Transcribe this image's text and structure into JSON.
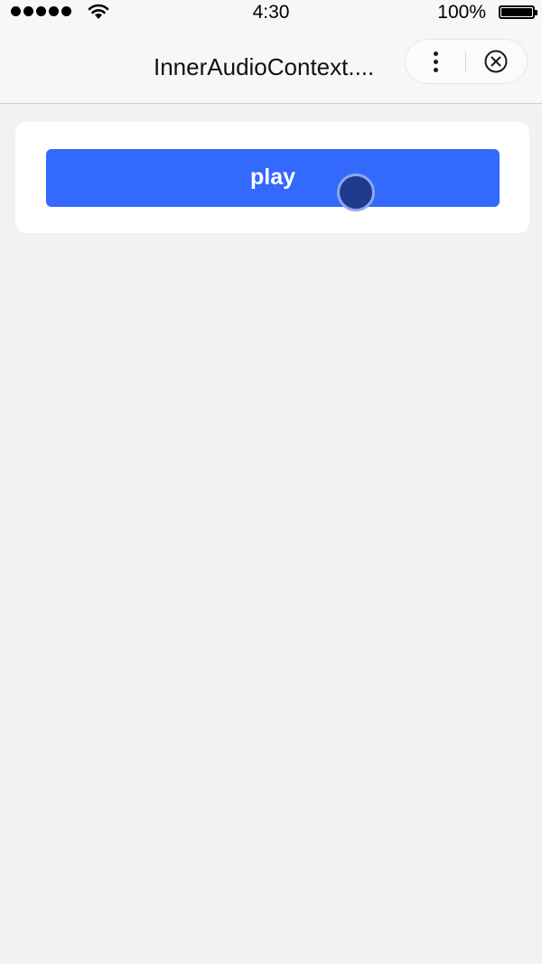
{
  "status_bar": {
    "time": "4:30",
    "battery_percent": "100%",
    "signal_bars": 5,
    "wifi_icon": "wifi-icon",
    "battery_icon": "battery-icon"
  },
  "nav": {
    "title": "InnerAudioContext....",
    "more_icon": "more-dots-icon",
    "close_icon": "close-circle-icon"
  },
  "main": {
    "play_label": "play"
  },
  "colors": {
    "background": "#f2f1f4",
    "nav_background": "#f7f7f9",
    "card_background": "#ffffff",
    "button_primary": "#3369fc",
    "button_text": "#ffffff",
    "touch_indicator": "#1f3b8e"
  }
}
